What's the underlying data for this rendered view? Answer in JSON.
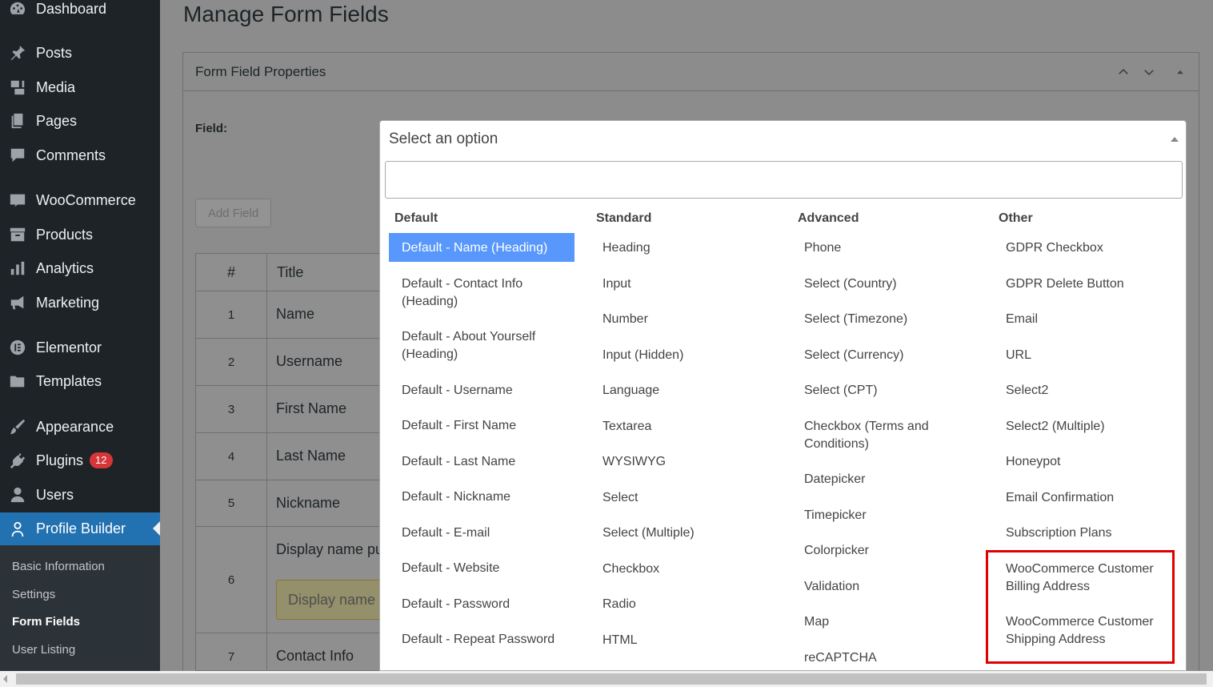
{
  "sidebar": {
    "items": [
      {
        "label": "Dashboard",
        "icon": "dashboard-icon"
      },
      {
        "label": "Posts",
        "icon": "pin-icon"
      },
      {
        "label": "Media",
        "icon": "media-icon"
      },
      {
        "label": "Pages",
        "icon": "pages-icon"
      },
      {
        "label": "Comments",
        "icon": "comment-icon"
      },
      {
        "label": "WooCommerce",
        "icon": "woo-icon"
      },
      {
        "label": "Products",
        "icon": "archive-icon"
      },
      {
        "label": "Analytics",
        "icon": "bar-chart-icon"
      },
      {
        "label": "Marketing",
        "icon": "megaphone-icon"
      },
      {
        "label": "Elementor",
        "icon": "elementor-icon"
      },
      {
        "label": "Templates",
        "icon": "folder-icon"
      },
      {
        "label": "Appearance",
        "icon": "brush-icon"
      },
      {
        "label": "Plugins",
        "icon": "plug-icon",
        "badge": "12"
      },
      {
        "label": "Users",
        "icon": "user-icon"
      },
      {
        "label": "Profile Builder",
        "icon": "person-icon"
      }
    ],
    "submenu": [
      {
        "label": "Basic Information"
      },
      {
        "label": "Settings"
      },
      {
        "label": "Form Fields"
      },
      {
        "label": "User Listing"
      }
    ]
  },
  "page": {
    "title": "Manage Form Fields",
    "postbox_title": "Form Field Properties",
    "field_label": "Field:",
    "add_field_label": "Add Field"
  },
  "table": {
    "headers": [
      "#",
      "Title"
    ],
    "rows": [
      {
        "num": "1",
        "title": "Name"
      },
      {
        "num": "2",
        "title": "Username"
      },
      {
        "num": "3",
        "title": "First Name"
      },
      {
        "num": "4",
        "title": "Last Name"
      },
      {
        "num": "5",
        "title": "Nickname"
      },
      {
        "num": "6",
        "title": "Display name pu",
        "input_value": "Display name p"
      },
      {
        "num": "7",
        "title": "Contact Info"
      }
    ]
  },
  "select": {
    "placeholder": "Select an option",
    "groups": [
      {
        "label": "Default",
        "options": [
          "Default - Name (Heading)",
          "Default - Contact Info (Heading)",
          "Default - About Yourself (Heading)",
          "Default - Username",
          "Default - First Name",
          "Default - Last Name",
          "Default - Nickname",
          "Default - E-mail",
          "Default - Website",
          "Default - Password",
          "Default - Repeat Password"
        ]
      },
      {
        "label": "Standard",
        "options": [
          "Heading",
          "Input",
          "Number",
          "Input (Hidden)",
          "Language",
          "Textarea",
          "WYSIWYG",
          "Select",
          "Select (Multiple)",
          "Checkbox",
          "Radio",
          "HTML"
        ]
      },
      {
        "label": "Advanced",
        "options": [
          "Phone",
          "Select (Country)",
          "Select (Timezone)",
          "Select (Currency)",
          "Select (CPT)",
          "Checkbox (Terms and Conditions)",
          "Datepicker",
          "Timepicker",
          "Colorpicker",
          "Validation",
          "Map",
          "reCAPTCHA"
        ]
      },
      {
        "label": "Other",
        "options": [
          "GDPR Checkbox",
          "GDPR Delete Button",
          "Email",
          "URL",
          "Select2",
          "Select2 (Multiple)",
          "Honeypot",
          "Email Confirmation",
          "Subscription Plans",
          "WooCommerce Customer Billing Address",
          "WooCommerce Customer Shipping Address"
        ]
      }
    ]
  },
  "colors": {
    "sidebar_bg": "#1d2327",
    "active_menu": "#2271b1",
    "highlight": "#5897fb",
    "badge": "#d63638",
    "annotation": "#e00000"
  }
}
